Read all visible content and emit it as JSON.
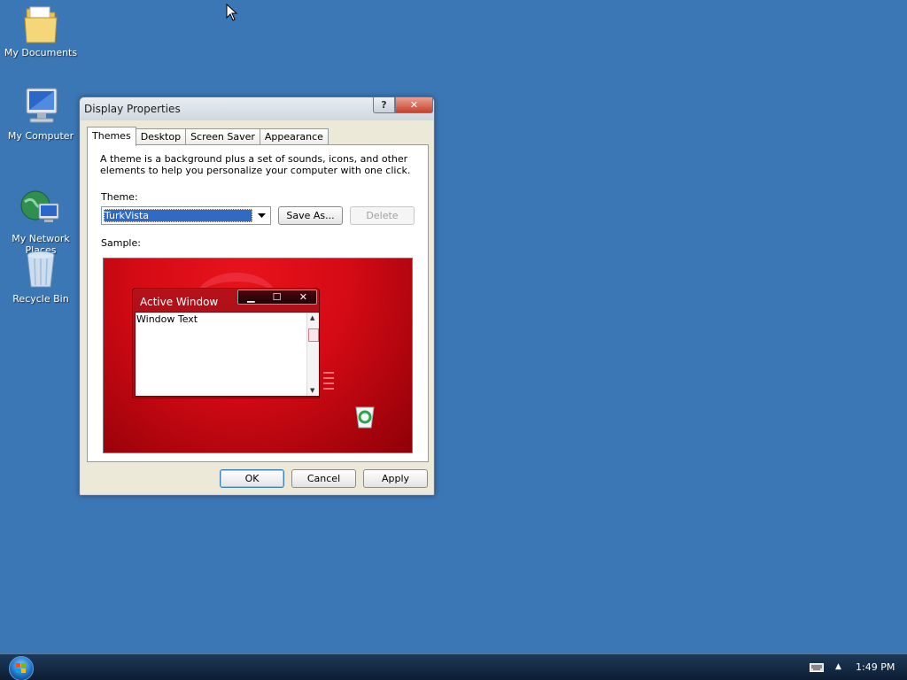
{
  "desktop": {
    "icons": [
      {
        "label": "My Documents",
        "icon": "folder-icon"
      },
      {
        "label": "My Computer",
        "icon": "computer-icon"
      },
      {
        "label": "My Network\nPlaces",
        "icon": "network-icon"
      },
      {
        "label": "Recycle Bin",
        "icon": "recycle-bin-icon"
      }
    ]
  },
  "window": {
    "title": "Display Properties",
    "help_label": "?",
    "close_label": "✕",
    "tabs": [
      "Themes",
      "Desktop",
      "Screen Saver",
      "Appearance"
    ],
    "active_tab": "Themes",
    "description": "A theme is a background plus a set of sounds, icons, and other elements to help you personalize your computer with one click.",
    "theme_label": "Theme:",
    "theme_value": "TurkVista",
    "save_as_label": "Save As...",
    "delete_label": "Delete",
    "sample_label": "Sample:",
    "sample": {
      "window_title": "Active Window",
      "window_text": "Window Text",
      "minimize": "▁",
      "maximize": "☐",
      "close": "✕"
    },
    "ok_label": "OK",
    "cancel_label": "Cancel",
    "apply_label": "Apply"
  },
  "taskbar": {
    "clock": "1:49 PM",
    "tray_arrow": "▲",
    "colors": {
      "desktop": "#3b77b5",
      "sample_bg": "#d40a14"
    }
  }
}
